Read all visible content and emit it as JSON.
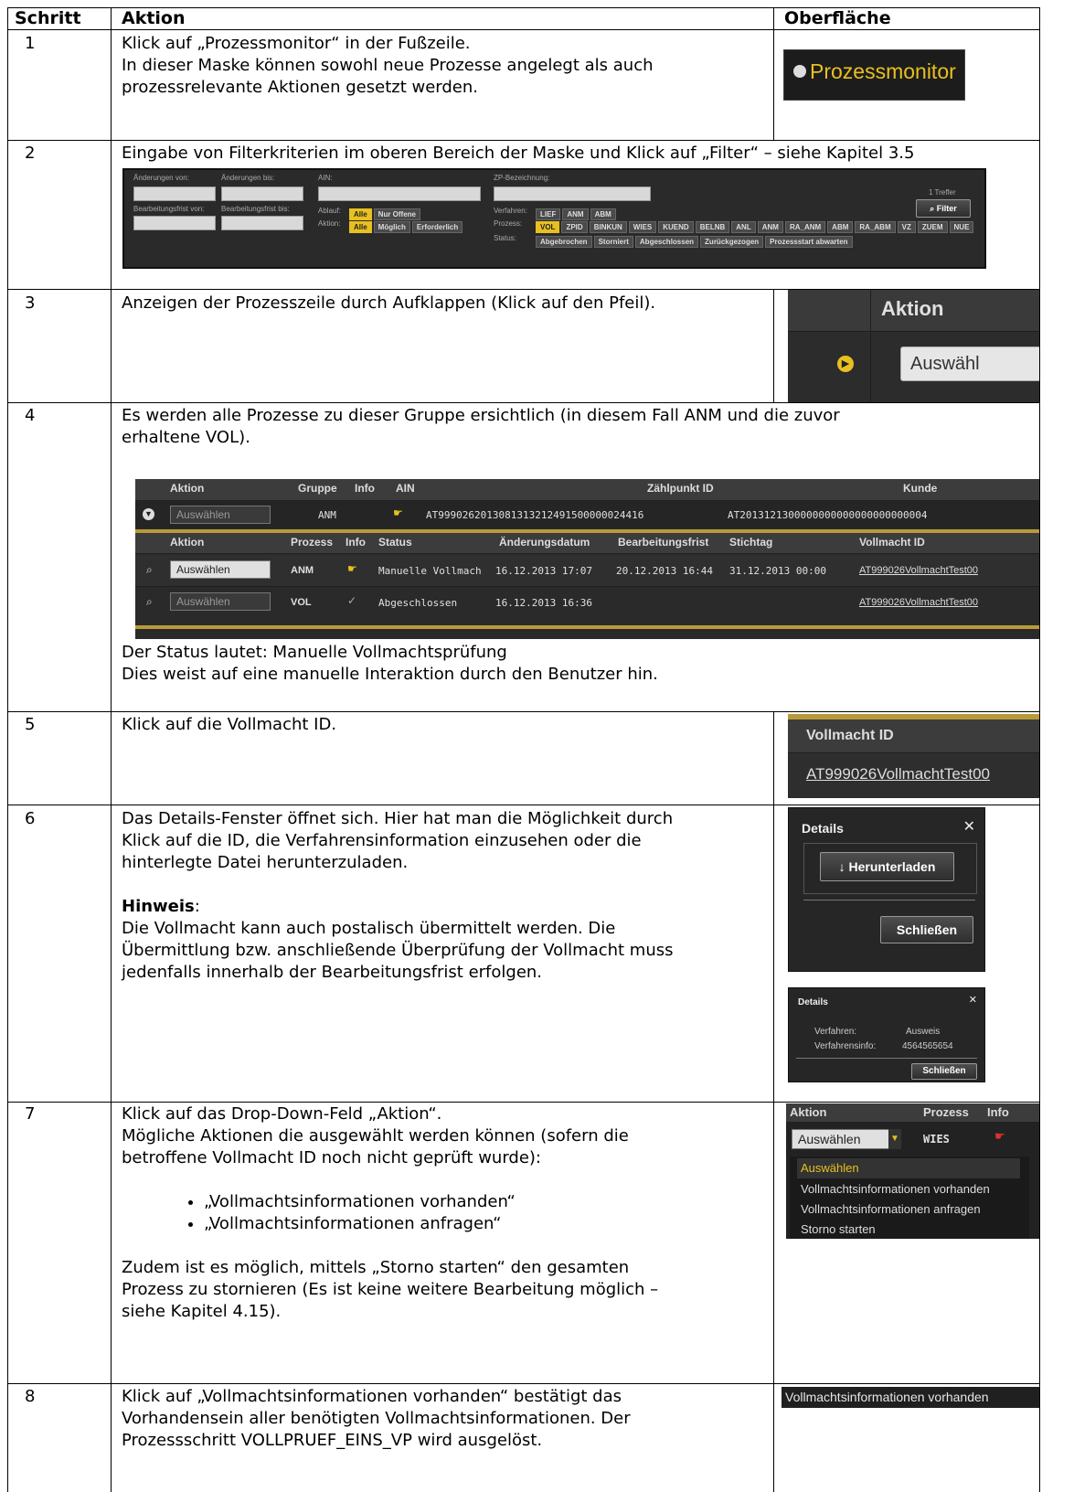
{
  "table": {
    "headers": {
      "step": "Schritt",
      "action": "Aktion",
      "surface": "Oberfläche"
    },
    "rows": [
      {
        "step": "1",
        "lines": [
          "Klick auf „Prozessmonitor“ in der Fußzeile.",
          "In dieser Maske können sowohl neue Prozesse angelegt als auch",
          "prozessrelevante Aktionen gesetzt werden."
        ]
      },
      {
        "step": "2",
        "lines": [
          "Eingabe von Filterkriterien im oberen Bereich der Maske und Klick auf „Filter“ – siehe Kapitel 3.5"
        ]
      },
      {
        "step": "3",
        "lines": [
          "Anzeigen der Prozesszeile durch Aufklappen (Klick auf den Pfeil)."
        ]
      },
      {
        "step": "4",
        "lines": [
          "Es werden alle Prozesse zu dieser Gruppe ersichtlich (in diesem Fall ANM und die zuvor",
          "erhaltene VOL)."
        ],
        "after": [
          "Der Status lautet: Manuelle Vollmachtsprüfung",
          "Dies weist auf eine manuelle Interaktion durch den Benutzer hin."
        ]
      },
      {
        "step": "5",
        "lines": [
          "Klick auf die Vollmacht ID."
        ]
      },
      {
        "step": "6",
        "lines": [
          "Das Details-Fenster öffnet sich. Hier hat man die Möglichkeit durch",
          "Klick auf die ID, die Verfahrensinformation einzusehen oder die",
          "hinterlegte Datei herunterzuladen."
        ],
        "hint_title": "Hinweis",
        "hint_colon": ":",
        "hint_lines": [
          "Die Vollmacht kann auch postalisch übermittelt werden. Die",
          "Übermittlung bzw. anschließende Überprüfung der Vollmacht muss",
          "jedenfalls innerhalb der Bearbeitungsfrist erfolgen."
        ]
      },
      {
        "step": "7",
        "lines": [
          "Klick auf das Drop-Down-Feld „Aktion“.",
          "Mögliche Aktionen die ausgewählt werden können (sofern die",
          "betroffene Vollmacht ID noch nicht geprüft wurde):"
        ],
        "bullets": [
          "„Vollmachtsinformationen vorhanden“",
          "„Vollmachtsinformationen anfragen“"
        ],
        "after": [
          "Zudem ist es möglich, mittels „Storno starten“ den gesamten",
          "Prozess zu stornieren (Es ist keine weitere Bearbeitung möglich –",
          "siehe Kapitel 4.15)."
        ]
      },
      {
        "step": "8",
        "lines": [
          "Klick auf „Vollmachtsinformationen vorhanden“ bestätigt das",
          "Vorhandensein aller benötigten Vollmachtsinformationen. Der",
          "Prozessschritt VOLLPRUEF_EINS_VP wird ausgelöst."
        ]
      }
    ]
  },
  "shot1": {
    "label": "Prozessmonitor"
  },
  "filter": {
    "labels": {
      "changes_from": "Änderungen von:",
      "changes_to": "Änderungen bis:",
      "ain": "AIN:",
      "zp": "ZP-Bezeichnung:",
      "deadline_from": "Bearbeitungsfrist von:",
      "deadline_to": "Bearbeitungsfrist bis:",
      "ablauf": "Ablauf:",
      "aktion": "Aktion:",
      "verfahren": "Verfahren:",
      "prozess": "Prozess:",
      "status": "Status:"
    },
    "ablauf": [
      "Alle",
      "Nur Offene"
    ],
    "aktion": [
      "Alle",
      "Möglich",
      "Erforderlich"
    ],
    "verfahren": [
      "LIEF",
      "ANM",
      "ABM"
    ],
    "prozess": [
      "VOL",
      "ZPID",
      "BINKUN",
      "WIES",
      "KUEND",
      "BELNB",
      "ANL",
      "ANM",
      "RA_ANM",
      "ABM",
      "RA_ABM",
      "VZ",
      "ZUEM",
      "NUE"
    ],
    "status": [
      "Abgebrochen",
      "Storniert",
      "Abgeschlossen",
      "Zurückgezogen",
      "Prozessstart abwarten"
    ],
    "hits": "1 Treffer",
    "filter_button": "Filter"
  },
  "shot3": {
    "header": "Aktion",
    "select": "Auswähl"
  },
  "grid": {
    "group_headers": [
      "Aktion",
      "Gruppe",
      "Info",
      "AIN",
      "Zählpunkt ID",
      "Kunde"
    ],
    "group_row": {
      "select": "Auswählen",
      "group": "ANM",
      "ain": "AT9990262013081313212491500000024416",
      "zp": "AT2013121300000000000000000000004"
    },
    "sub_headers": [
      "Aktion",
      "Prozess",
      "Info",
      "Status",
      "Änderungsdatum",
      "Bearbeitungsfrist",
      "Stichtag",
      "Vollmacht ID"
    ],
    "sub_rows": [
      {
        "select": "Auswählen",
        "process": "ANM",
        "status": "Manuelle Vollmach",
        "changed": "16.12.2013 17:07",
        "deadline": "20.12.2013 16:44",
        "stichtag": "31.12.2013 00:00",
        "vid": "AT999026VollmachtTest00"
      },
      {
        "select": "Auswählen",
        "process": "VOL",
        "status": "Abgeschlossen",
        "changed": "16.12.2013 16:36",
        "deadline": "",
        "stichtag": "",
        "vid": "AT999026VollmachtTest00"
      }
    ]
  },
  "shot5": {
    "header": "Vollmacht ID",
    "link": "AT999026VollmachtTest00"
  },
  "details1": {
    "title": "Details",
    "download": "Herunterladen",
    "close": "Schließen"
  },
  "details2": {
    "title": "Details",
    "k1": "Verfahren:",
    "v1": "Ausweis",
    "k2": "Verfahrensinfo:",
    "v2": "4564565654",
    "close": "Schließen"
  },
  "dropdown": {
    "headers": [
      "Aktion",
      "Prozess",
      "Info"
    ],
    "select": "Auswählen",
    "process": "WIES",
    "options": [
      "Auswählen",
      "Vollmachtsinformationen vorhanden",
      "Vollmachtsinformationen anfragen",
      "Storno starten"
    ]
  },
  "shot8": {
    "label": "Vollmachtsinformationen vorhanden"
  },
  "colors": {
    "accent": "#e8c020",
    "panel": "#2a2a2a"
  }
}
